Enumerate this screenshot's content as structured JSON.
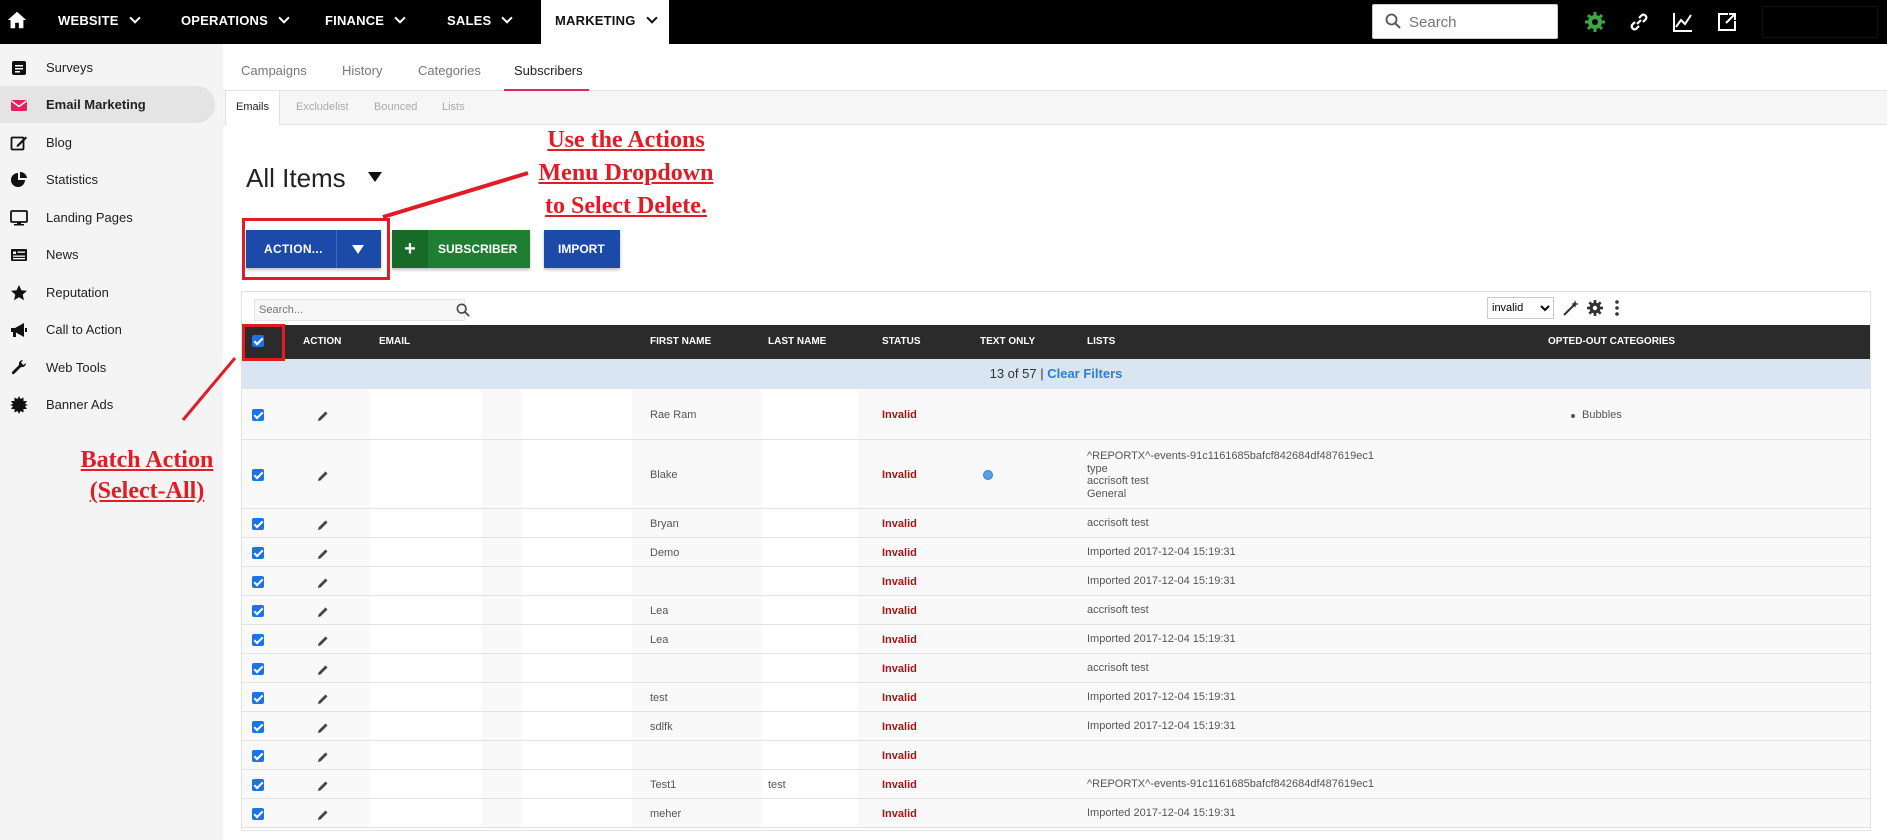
{
  "topnav": {
    "items": [
      {
        "label": "WEBSITE"
      },
      {
        "label": "OPERATIONS"
      },
      {
        "label": "FINANCE"
      },
      {
        "label": "SALES"
      },
      {
        "label": "MARKETING"
      }
    ],
    "search_placeholder": "Search"
  },
  "sidebar": {
    "items": [
      {
        "label": "Surveys",
        "icon": "survey-icon"
      },
      {
        "label": "Email Marketing",
        "icon": "envelope-icon"
      },
      {
        "label": "Blog",
        "icon": "edit-icon"
      },
      {
        "label": "Statistics",
        "icon": "pie-chart-icon"
      },
      {
        "label": "Landing Pages",
        "icon": "monitor-icon"
      },
      {
        "label": "News",
        "icon": "newspaper-icon"
      },
      {
        "label": "Reputation",
        "icon": "star-icon"
      },
      {
        "label": "Call to Action",
        "icon": "megaphone-icon"
      },
      {
        "label": "Web Tools",
        "icon": "wrench-icon"
      },
      {
        "label": "Banner Ads",
        "icon": "badge-icon"
      }
    ]
  },
  "tabs": [
    "Campaigns",
    "History",
    "Categories",
    "Subscribers"
  ],
  "subtabs": [
    "Emails",
    "Excludelist",
    "Bounced",
    "Lists"
  ],
  "page_title": "All Items",
  "buttons": {
    "action": "ACTION...",
    "subscriber": "SUBSCRIBER",
    "import": "IMPORT"
  },
  "annotations": {
    "actions_line1": "Use the Actions",
    "actions_line2": "Menu Dropdown",
    "actions_line3": "to Select Delete.",
    "batch_line1": "Batch Action",
    "batch_line2": "(Select-All)"
  },
  "grid": {
    "search_placeholder": "Search...",
    "filter_value": "invalid",
    "columns": [
      "ACTION",
      "EMAIL",
      "FIRST NAME",
      "LAST NAME",
      "STATUS",
      "TEXT ONLY",
      "LISTS",
      "OPTED-OUT CATEGORIES"
    ],
    "filter_summary": "13 of 57 |",
    "clear_filters": "Clear Filters",
    "rows": [
      {
        "first": "Rae Ram",
        "last": "",
        "status": "Invalid",
        "lists": [],
        "opted": "Bubbles"
      },
      {
        "first": "Blake",
        "last": "",
        "status": "Invalid",
        "lists": [
          "^REPORTX^-events-91c1161685bafcf842684df487619ec1",
          "type",
          "accrisoft test",
          "General"
        ],
        "opted": ""
      },
      {
        "first": "Bryan",
        "last": "",
        "status": "Invalid",
        "lists": [
          "accrisoft test"
        ],
        "opted": ""
      },
      {
        "first": "Demo",
        "last": "",
        "status": "Invalid",
        "lists": [
          "Imported 2017-12-04 15:19:31"
        ],
        "opted": ""
      },
      {
        "first": "",
        "last": "",
        "status": "Invalid",
        "lists": [
          "Imported 2017-12-04 15:19:31"
        ],
        "opted": ""
      },
      {
        "first": "Lea",
        "last": "",
        "status": "Invalid",
        "lists": [
          "accrisoft test"
        ],
        "opted": ""
      },
      {
        "first": "Lea",
        "last": "",
        "status": "Invalid",
        "lists": [
          "Imported 2017-12-04 15:19:31"
        ],
        "opted": ""
      },
      {
        "first": "",
        "last": "",
        "status": "Invalid",
        "lists": [
          "accrisoft test"
        ],
        "opted": ""
      },
      {
        "first": "test",
        "last": "",
        "status": "Invalid",
        "lists": [
          "Imported 2017-12-04 15:19:31"
        ],
        "opted": ""
      },
      {
        "first": "sdlfk",
        "last": "",
        "status": "Invalid",
        "lists": [
          "Imported 2017-12-04 15:19:31"
        ],
        "opted": ""
      },
      {
        "first": "",
        "last": "",
        "status": "Invalid",
        "lists": [],
        "opted": ""
      },
      {
        "first": "Test1",
        "last": "test",
        "status": "Invalid",
        "lists": [
          "^REPORTX^-events-91c1161685bafcf842684df487619ec1"
        ],
        "opted": ""
      },
      {
        "first": "meher",
        "last": "",
        "status": "Invalid",
        "lists": [
          "Imported 2017-12-04 15:19:31"
        ],
        "opted": ""
      }
    ]
  }
}
